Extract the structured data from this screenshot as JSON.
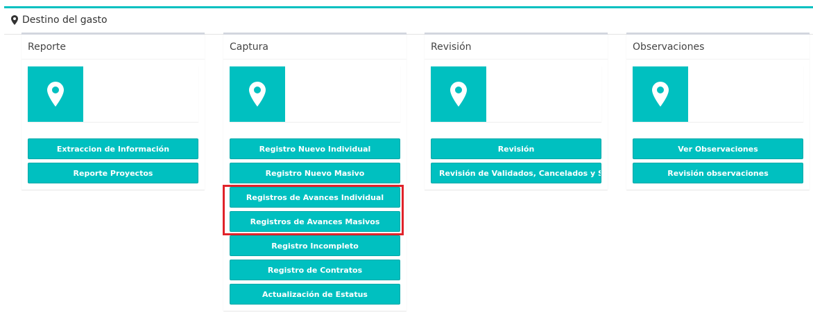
{
  "section": {
    "title": "Destino del gasto",
    "icon": "map-marker-icon"
  },
  "panels": [
    {
      "title": "Reporte",
      "buttons": [
        "Extraccion de Información",
        "Reporte Proyectos"
      ]
    },
    {
      "title": "Captura",
      "buttons": [
        "Registro Nuevo Individual",
        "Registro Nuevo Masivo",
        "Registros de Avances Individual",
        "Registros de Avances Masivos",
        "Registro Incompleto",
        "Registro de Contratos",
        "Actualización de Estatus"
      ]
    },
    {
      "title": "Revisión",
      "buttons": [
        "Revisión",
        "Revisión de Validados, Cancelados y Suspend"
      ]
    },
    {
      "title": "Observaciones",
      "buttons": [
        "Ver Observaciones",
        "Revisión observaciones"
      ]
    }
  ],
  "colors": {
    "accent": "#00c0c0",
    "highlight": "#e0232a"
  }
}
